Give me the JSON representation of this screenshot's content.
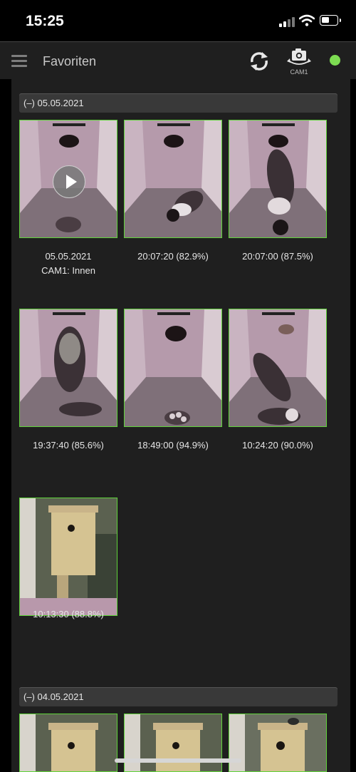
{
  "status_bar": {
    "time": "15:25"
  },
  "header": {
    "title": "Favoriten",
    "camera_label": "CAM1",
    "connection_color": "#7ddc52"
  },
  "icons": [
    "menu-icon",
    "refresh-icon",
    "camera-switch-icon",
    "play-icon",
    "signal-icon",
    "wifi-icon",
    "battery-icon"
  ],
  "sections": [
    {
      "label": "(–) 05.05.2021",
      "items": [
        {
          "line1": "05.05.2021",
          "line2": "CAM1: Innen",
          "has_play": true
        },
        {
          "line1": "20:07:20 (82.9%)"
        },
        {
          "line1": "20:07:00 (87.5%)"
        },
        {
          "line1": "19:37:40 (85.6%)"
        },
        {
          "line1": "18:49:00 (94.9%)"
        },
        {
          "line1": "10:24:20 (90.0%)"
        },
        {
          "line1": "10:13:30 (88.8%)"
        }
      ]
    },
    {
      "label": "(–) 04.05.2021",
      "items": [
        {},
        {},
        {}
      ]
    }
  ],
  "colors": {
    "thumb_border": "#5fd33a",
    "panel": "#1f1f1f",
    "section_header": "#393939"
  }
}
